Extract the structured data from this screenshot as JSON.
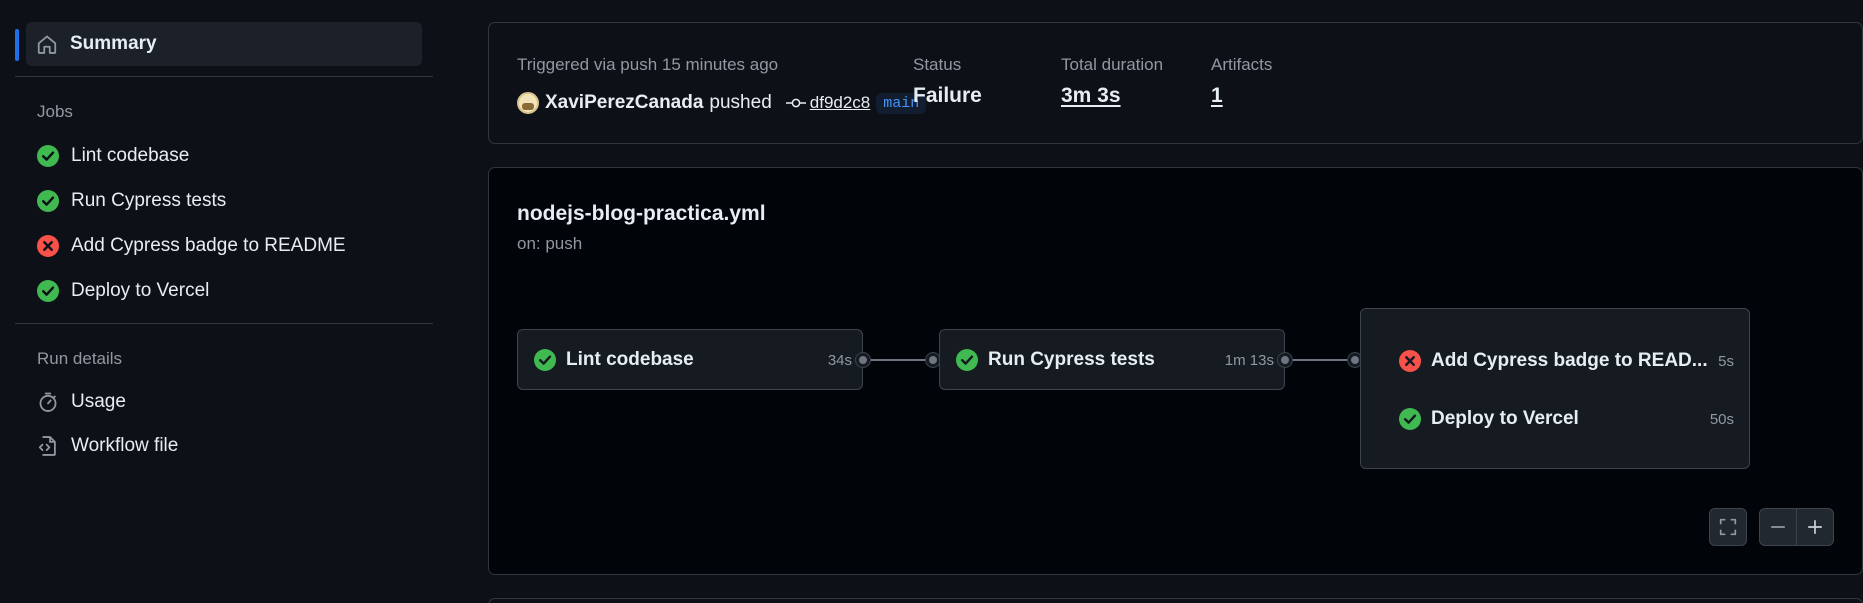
{
  "sidebar": {
    "summary_label": "Summary",
    "jobs_heading": "Jobs",
    "jobs": [
      {
        "label": "Lint codebase",
        "status": "success"
      },
      {
        "label": "Run Cypress tests",
        "status": "success"
      },
      {
        "label": "Add Cypress badge to README",
        "status": "failure"
      },
      {
        "label": "Deploy to Vercel",
        "status": "success"
      }
    ],
    "run_details_heading": "Run details",
    "usage_label": "Usage",
    "workflow_file_label": "Workflow file"
  },
  "run": {
    "trigger_text": "Triggered via push 15 minutes ago",
    "actor": "XaviPerezCanada",
    "action": "pushed",
    "sha": "df9d2c8",
    "branch": "main",
    "status_label": "Status",
    "status_value": "Failure",
    "duration_label": "Total duration",
    "duration_value": "3m 3s",
    "artifacts_label": "Artifacts",
    "artifacts_value": "1"
  },
  "workflow": {
    "filename": "nodejs-blog-practica.yml",
    "trigger": "on: push",
    "jobs": [
      {
        "name": "Lint codebase",
        "duration": "34s",
        "status": "success"
      },
      {
        "name": "Run Cypress tests",
        "duration": "1m 13s",
        "status": "success"
      },
      {
        "name": "Add Cypress badge to READ...",
        "duration": "5s",
        "status": "failure"
      },
      {
        "name": "Deploy to Vercel",
        "duration": "50s",
        "status": "success"
      }
    ]
  },
  "colors": {
    "success": "#3fb950",
    "failure": "#f85149",
    "accent": "#1f6feb",
    "background": "#0d1117"
  },
  "icons": {
    "summary": "home-icon",
    "success": "check-circle-icon",
    "failure": "x-circle-icon",
    "usage": "stopwatch-icon",
    "workflow_file": "file-code-icon",
    "commit": "git-commit-icon",
    "fullscreen": "fullscreen-icon",
    "zoom_out": "zoom-out-icon",
    "zoom_in": "zoom-in-icon"
  }
}
